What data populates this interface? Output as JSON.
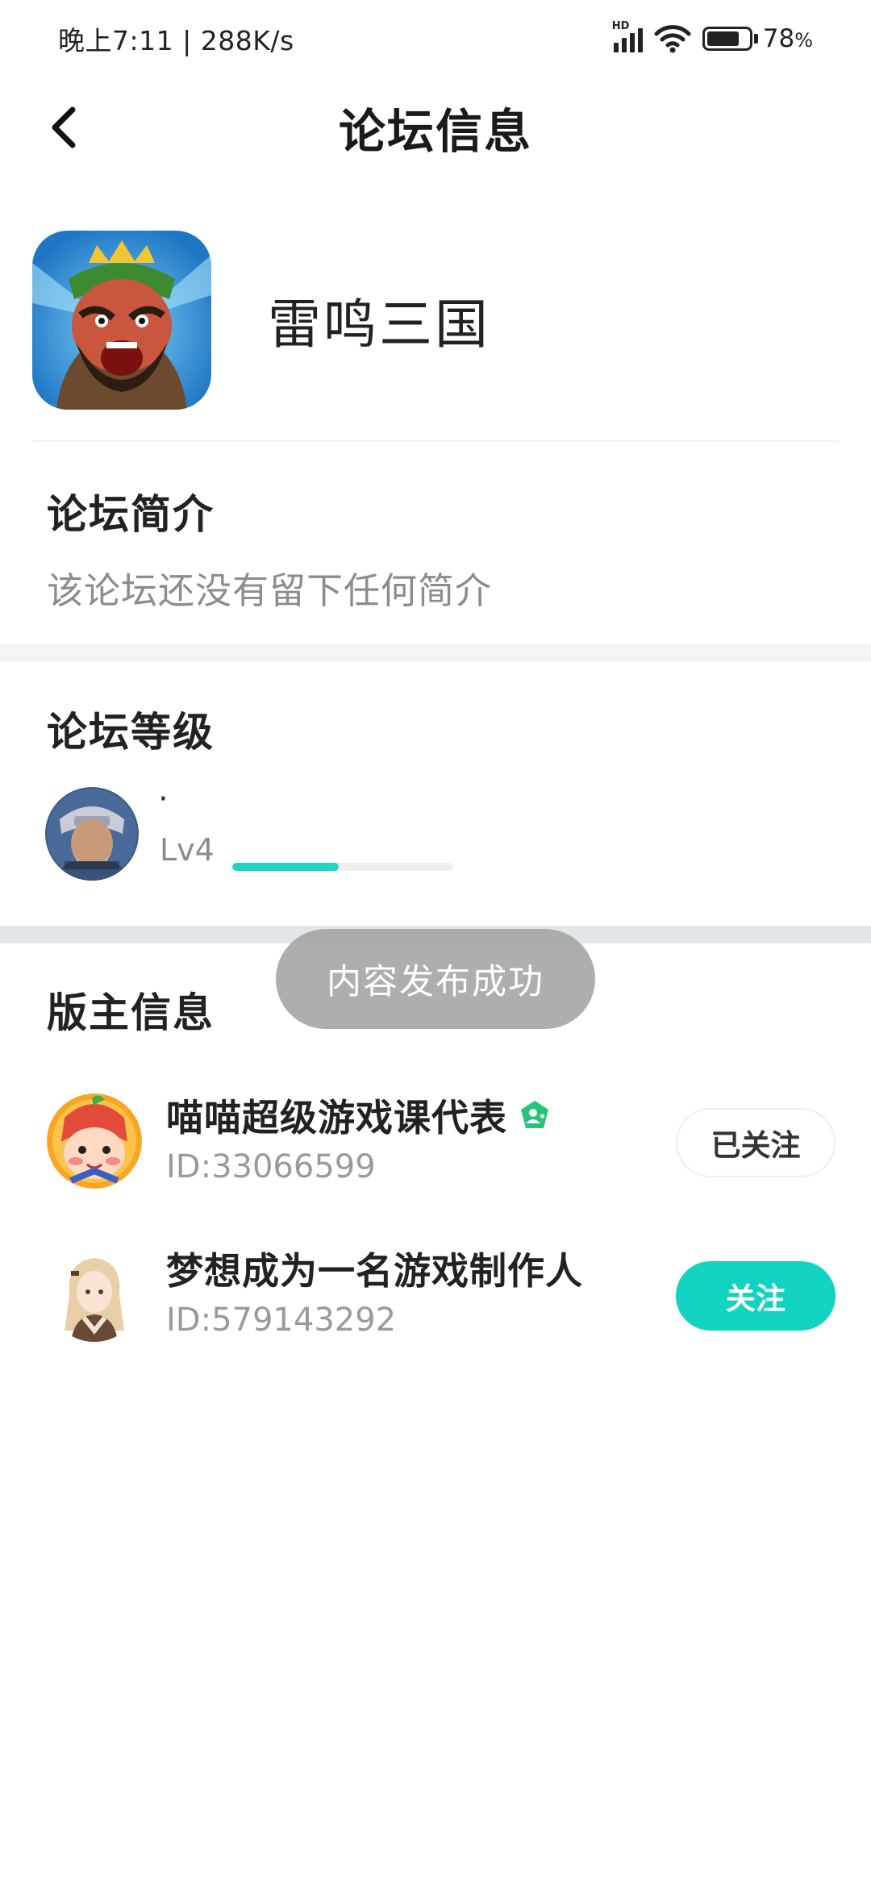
{
  "status_bar": {
    "time_speed": "晚上7:11 | 288K/s",
    "signal_label": "HD",
    "battery_percent": "78",
    "battery_unit": "%",
    "icons": [
      "hd-signal-icon",
      "wifi-icon",
      "battery-icon"
    ]
  },
  "header": {
    "title": "论坛信息",
    "back_icon": "chevron-left-icon"
  },
  "forum": {
    "name": "雷鸣三国",
    "icon": "game-app-icon"
  },
  "intro": {
    "title": "论坛简介",
    "text": "该论坛还没有留下任何简介"
  },
  "level": {
    "title": "论坛等级",
    "user_name": "·",
    "level_label": "Lv4",
    "progress": 0.48,
    "progress_color": "#21d4c2"
  },
  "toast": {
    "text": "内容发布成功"
  },
  "moderators": {
    "title": "版主信息",
    "items": [
      {
        "name": "喵喵超级游戏课代表",
        "id_text": "ID:33066599",
        "badge": "verified-user-icon",
        "button_label": "已关注",
        "followed": true
      },
      {
        "name": "梦想成为一名游戏制作人",
        "id_text": "ID:579143292",
        "badge": "",
        "button_label": "关注",
        "followed": false
      }
    ]
  },
  "colors": {
    "accent": "#12d3c0",
    "badge_green": "#27c37a",
    "secondary_text": "#8c8c8c"
  }
}
